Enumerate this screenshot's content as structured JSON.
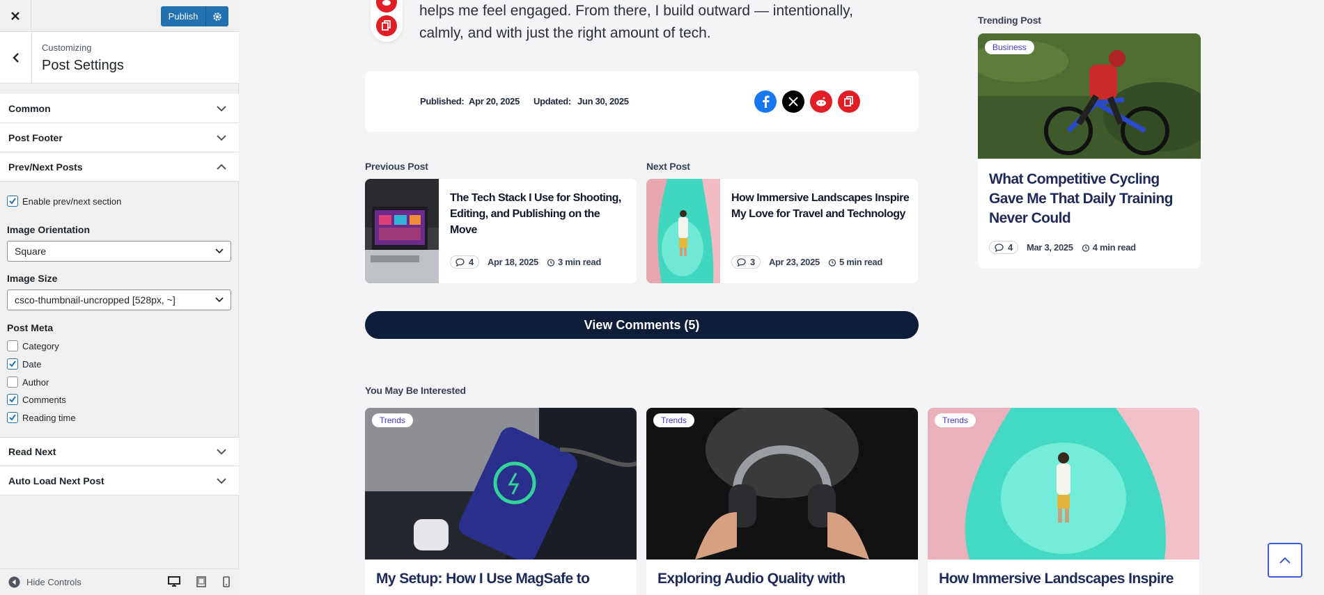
{
  "customizer": {
    "publish_label": "Publish",
    "title_small": "Customizing",
    "title_big": "Post Settings",
    "sections": {
      "common": "Common",
      "post_footer": "Post Footer",
      "prev_next": "Prev/Next Posts",
      "read_next": "Read Next",
      "auto_load": "Auto Load Next Post"
    },
    "enable_prev_next": "Enable prev/next section",
    "image_orientation_label": "Image Orientation",
    "image_orientation_value": "Square",
    "image_size_label": "Image Size",
    "image_size_value": "csco-thumbnail-uncropped [528px, ~]",
    "post_meta_label": "Post Meta",
    "post_meta": [
      {
        "label": "Category",
        "checked": false
      },
      {
        "label": "Date",
        "checked": true
      },
      {
        "label": "Author",
        "checked": false
      },
      {
        "label": "Comments",
        "checked": true
      },
      {
        "label": "Reading time",
        "checked": true
      }
    ],
    "hide_controls": "Hide Controls"
  },
  "article": {
    "intro_line1": "helps me feel engaged. From there, I build outward — intentionally,",
    "intro_line2": "calmly, and with just the right amount of tech.",
    "published_label": "Published:",
    "published_date": "Apr 20, 2025",
    "updated_label": "Updated:",
    "updated_date": "Jun 30, 2025"
  },
  "prev_post": {
    "heading": "Previous Post",
    "title": "The Tech Stack I Use for Shooting, Editing, and Publishing on the Move",
    "comments": "4",
    "date": "Apr 18, 2025",
    "read": "3 min read"
  },
  "next_post": {
    "heading": "Next Post",
    "title": "How Immersive Landscapes Inspire My Love for Travel and Technology",
    "comments": "3",
    "date": "Apr 23, 2025",
    "read": "5 min read"
  },
  "view_comments": "View Comments (5)",
  "trending": {
    "heading": "Trending Post",
    "badge": "Business",
    "title": "What Competitive Cycling Gave Me That Daily Training Never Could",
    "comments": "4",
    "date": "Mar 3, 2025",
    "read": "4 min read"
  },
  "interested": {
    "heading": "You May Be Interested",
    "items": [
      {
        "badge": "Trends",
        "title": "My Setup: How I Use MagSafe to"
      },
      {
        "badge": "Trends",
        "title": "Exploring Audio Quality with"
      },
      {
        "badge": "Trends",
        "title": "How Immersive Landscapes Inspire"
      }
    ]
  },
  "colors": {
    "accent": "#2271b1",
    "button_dark": "#0f1d3a",
    "badge_text": "#4338ca",
    "share_red": "#e11d26",
    "facebook": "#1877f2"
  }
}
